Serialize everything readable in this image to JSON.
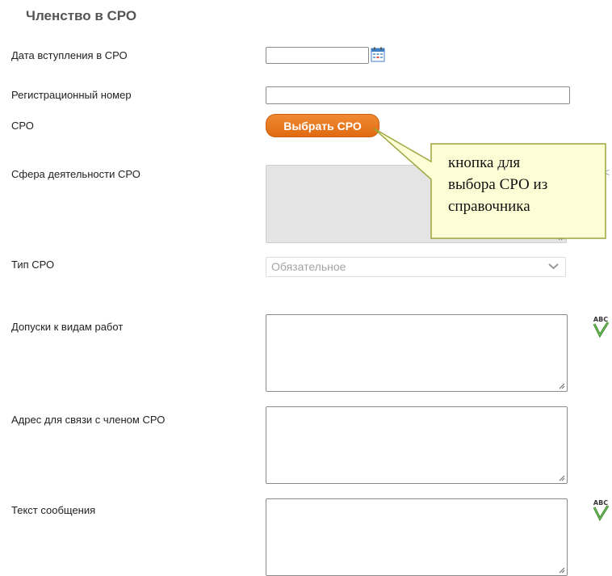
{
  "section": {
    "title": "Членство в СРО"
  },
  "fields": {
    "join_date": {
      "label": "Дата вступления в СРО",
      "value": ""
    },
    "reg_number": {
      "label": "Регистрационный номер",
      "value": ""
    },
    "sro": {
      "label": "СРО",
      "button_label": "Выбрать СРО"
    },
    "activity_scope": {
      "label": "Сфера деятельности СРО",
      "value": ""
    },
    "sro_type": {
      "label": "Тип СРО",
      "selected": "Обязательное"
    },
    "work_permits": {
      "label": "Допуски к видам работ",
      "value": ""
    },
    "contact_address": {
      "label": "Адрес для связи с членом СРО",
      "value": ""
    },
    "message_text": {
      "label": "Текст сообщения",
      "value": ""
    }
  },
  "callout": {
    "line1": "кнопка для",
    "line2": "выбора СРО из",
    "line3": "справочника"
  },
  "icons": {
    "calendar": "calendar-icon",
    "spellcheck": "spellcheck-icon",
    "dropdown": "chevron-down-icon"
  },
  "colors": {
    "button_bg": "#e8761f",
    "callout_bg": "#fefed6",
    "callout_border": "#9aa53c",
    "disabled_bg": "#e4e4e4"
  }
}
